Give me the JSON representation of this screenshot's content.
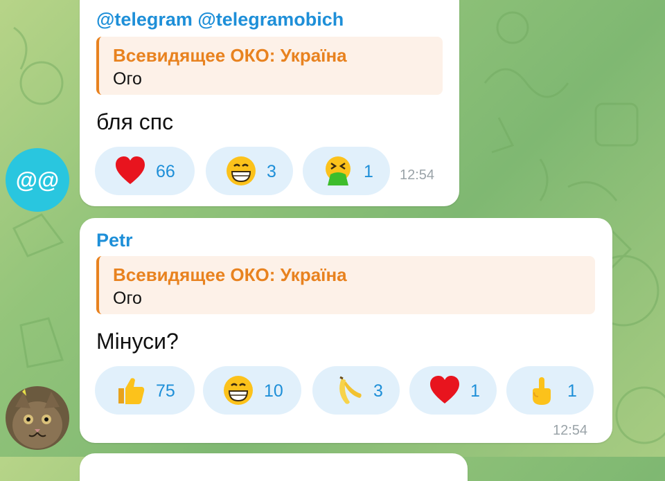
{
  "messages": [
    {
      "sender": "@telegram @telegramobich",
      "reply_title": "Всевидящее ОКО: Україна",
      "reply_text": "Ого",
      "text": "бля спс",
      "time": "12:54",
      "avatar_text": "@@",
      "reactions": [
        {
          "emoji": "heart-icon",
          "count": "66"
        },
        {
          "emoji": "grinning-face-icon",
          "count": "3"
        },
        {
          "emoji": "vomiting-face-icon",
          "count": "1"
        }
      ]
    },
    {
      "sender": "Petr",
      "reply_title": "Всевидящее ОКО: Україна",
      "reply_text": "Ого",
      "text": "Мінуси?",
      "time": "12:54",
      "reactions": [
        {
          "emoji": "thumbs-up-icon",
          "count": "75"
        },
        {
          "emoji": "grinning-face-icon",
          "count": "10"
        },
        {
          "emoji": "banana-icon",
          "count": "3"
        },
        {
          "emoji": "heart-icon",
          "count": "1"
        },
        {
          "emoji": "middle-finger-icon",
          "count": "1"
        }
      ]
    }
  ],
  "colors": {
    "sender": "#1e8fd8",
    "reply_accent": "#e8821f",
    "reaction_bg": "#e1f0fb",
    "time": "#9aa3a8"
  }
}
